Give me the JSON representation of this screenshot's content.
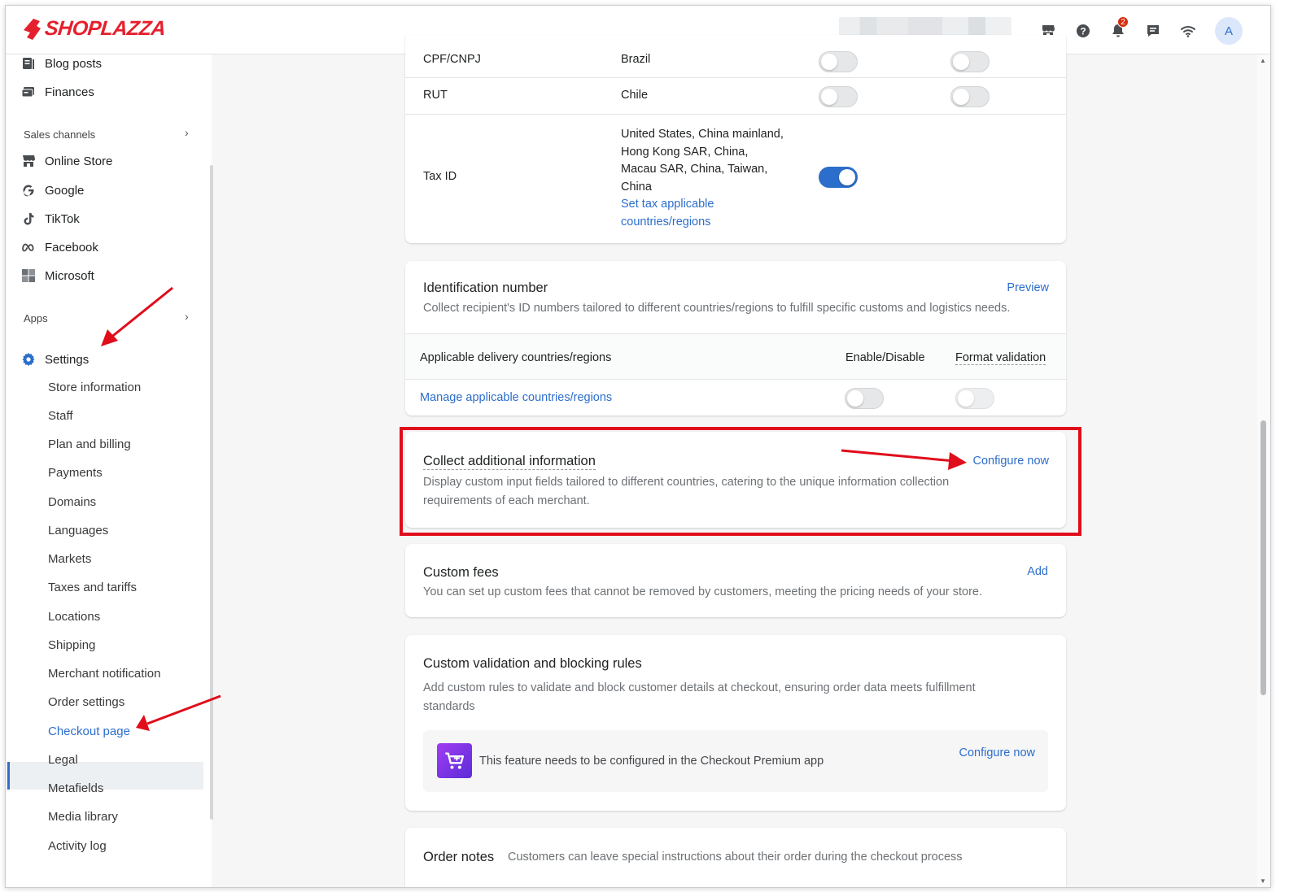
{
  "brand": {
    "name": "SHOPLAZZA",
    "color": "#e5202e"
  },
  "topbar": {
    "icons": [
      "storefront-icon",
      "help-icon",
      "bell-icon",
      "chat-icon",
      "wifi-icon"
    ],
    "notification_count": "2",
    "avatar_initial": "A"
  },
  "sidebar": {
    "top_items": [
      {
        "label": "Blog posts",
        "icon": "blog-icon"
      },
      {
        "label": "Finances",
        "icon": "finances-icon"
      }
    ],
    "sales_channels_label": "Sales channels",
    "channels": [
      {
        "label": "Online Store",
        "icon": "store-icon"
      },
      {
        "label": "Google",
        "icon": "google-icon"
      },
      {
        "label": "TikTok",
        "icon": "tiktok-icon"
      },
      {
        "label": "Facebook",
        "icon": "meta-icon"
      },
      {
        "label": "Microsoft",
        "icon": "microsoft-icon"
      }
    ],
    "apps_label": "Apps",
    "settings_label": "Settings",
    "settings_items": [
      "Store information",
      "Staff",
      "Plan and billing",
      "Payments",
      "Domains",
      "Languages",
      "Markets",
      "Taxes and tariffs",
      "Locations",
      "Shipping",
      "Merchant notification",
      "Order settings",
      "Checkout page",
      "Legal",
      "Metafields",
      "Media library",
      "Activity log"
    ],
    "active_item": "Checkout page"
  },
  "tax_table": {
    "rows": [
      {
        "name": "CPF/CNPJ",
        "countries": "Brazil",
        "enabled": false,
        "validation": false
      },
      {
        "name": "RUT",
        "countries": "Chile",
        "enabled": false,
        "validation": false
      }
    ],
    "tax_id": {
      "name": "Tax ID",
      "countries_lines": [
        "United States, China mainland,",
        "Hong Kong SAR, China,",
        "Macau SAR, China, Taiwan,",
        "China"
      ],
      "link_lines": [
        "Set tax applicable",
        "countries/regions"
      ],
      "enabled": true
    }
  },
  "identification": {
    "title": "Identification number",
    "action": "Preview",
    "description": "Collect recipient's ID numbers tailored to different countries/regions to fulfill specific customs and logistics needs.",
    "col_countries": "Applicable delivery countries/regions",
    "col_enable": "Enable/Disable",
    "col_validation": "Format validation",
    "manage_link": "Manage applicable countries/regions",
    "enabled": false,
    "validation": false
  },
  "collect_info": {
    "title": "Collect additional information",
    "action": "Configure now",
    "description_lines": [
      "Display custom input fields tailored to different countries, catering to the unique information collection",
      "requirements of each merchant."
    ]
  },
  "custom_fees": {
    "title": "Custom fees",
    "action": "Add",
    "description": "You can set up custom fees that cannot be removed by customers, meeting the pricing needs of your store."
  },
  "validation_rules": {
    "title": "Custom validation and blocking rules",
    "description_lines": [
      "Add custom rules to validate and block customer details at checkout, ensuring order data meets fulfillment",
      "standards"
    ],
    "premium_text": "This feature needs to be configured in the Checkout Premium app",
    "premium_action": "Configure now"
  },
  "order_notes": {
    "title": "Order notes",
    "description": "Customers can leave special instructions about their order during the checkout process"
  },
  "colors": {
    "accent": "#2c6ecb",
    "annotation": "#e00d1a"
  }
}
